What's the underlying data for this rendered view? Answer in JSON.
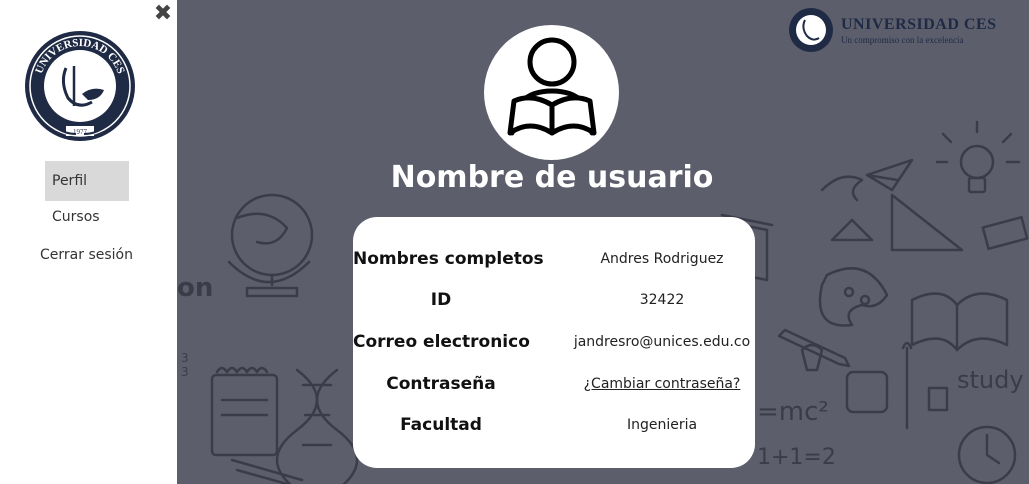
{
  "sidebar": {
    "close_symbol": "✖",
    "items": [
      {
        "label": "Perfil",
        "active": true
      },
      {
        "label": "Cursos",
        "active": false
      },
      {
        "label": "Cerrar sesión",
        "active": false
      }
    ],
    "logo": {
      "text": "UNIVERSIDAD CES",
      "year": "1977"
    }
  },
  "header": {
    "brand_name": "UNIVERSIDAD CES",
    "brand_tagline": "Un compromiso con la excelencia"
  },
  "profile": {
    "title": "Nombre de usuario",
    "avatar_icon": "person-reading-icon",
    "fields": [
      {
        "label": "Nombres completos",
        "value": "Andres Rodriguez"
      },
      {
        "label": "ID",
        "value": "32422"
      },
      {
        "label": "Correo electronico",
        "value": "jandresro@unices.edu.co"
      },
      {
        "label": "Contraseña",
        "value": "¿Cambiar contraseña?"
      },
      {
        "label": "Facultad",
        "value": "Ingenieria"
      }
    ]
  },
  "background_words": {
    "left": "on",
    "right": "study",
    "formula": "=mc²",
    "math": "1+1=2"
  },
  "colors": {
    "background": "#5c5e6c",
    "active_nav": "#d9d9d9",
    "brand": "#1f2a44"
  }
}
